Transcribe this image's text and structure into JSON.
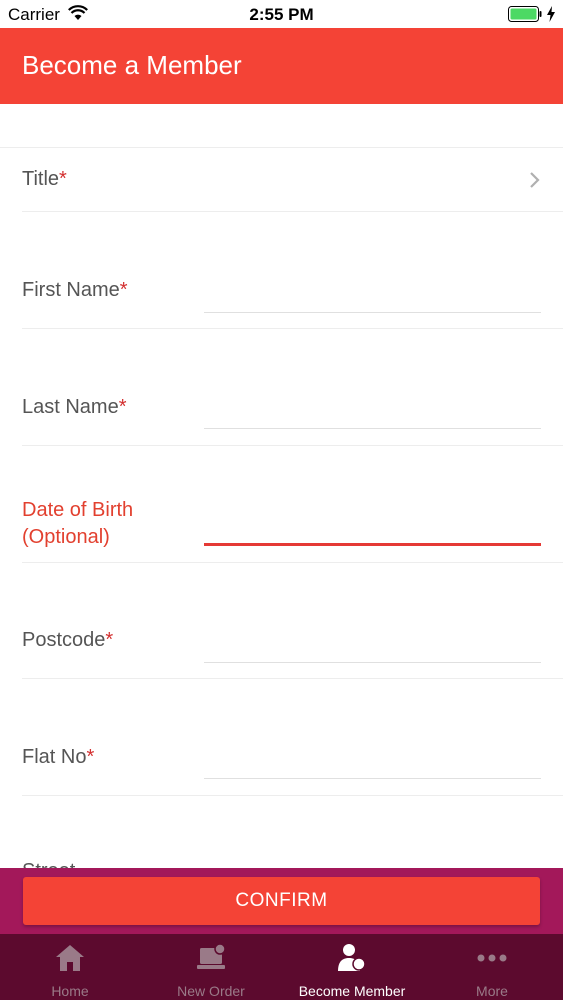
{
  "status_bar": {
    "carrier": "Carrier",
    "time": "2:55 PM"
  },
  "header": {
    "title": "Become a Member"
  },
  "form": {
    "fields": [
      {
        "label": "Title",
        "required": "*"
      },
      {
        "label": "First Name",
        "required": "*"
      },
      {
        "label": "Last Name",
        "required": "*"
      },
      {
        "label_line1": "Date of Birth",
        "label_line2": "(Optional)"
      },
      {
        "label": "Postcode",
        "required": "*"
      },
      {
        "label": "Flat No",
        "required": "*"
      },
      {
        "label": "Street"
      }
    ]
  },
  "confirm_button": {
    "label": "CONFIRM"
  },
  "tabs": [
    {
      "label": "Home",
      "icon": "home-icon"
    },
    {
      "label": "New Order",
      "icon": "laptop-icon"
    },
    {
      "label": "Become Member",
      "icon": "member-icon"
    },
    {
      "label": "More",
      "icon": "more-icon"
    }
  ],
  "colors": {
    "accent": "#f44336",
    "confirm_bar": "#a3185a",
    "tab_bar": "#5c0a2e",
    "required": "#d32f2f"
  }
}
